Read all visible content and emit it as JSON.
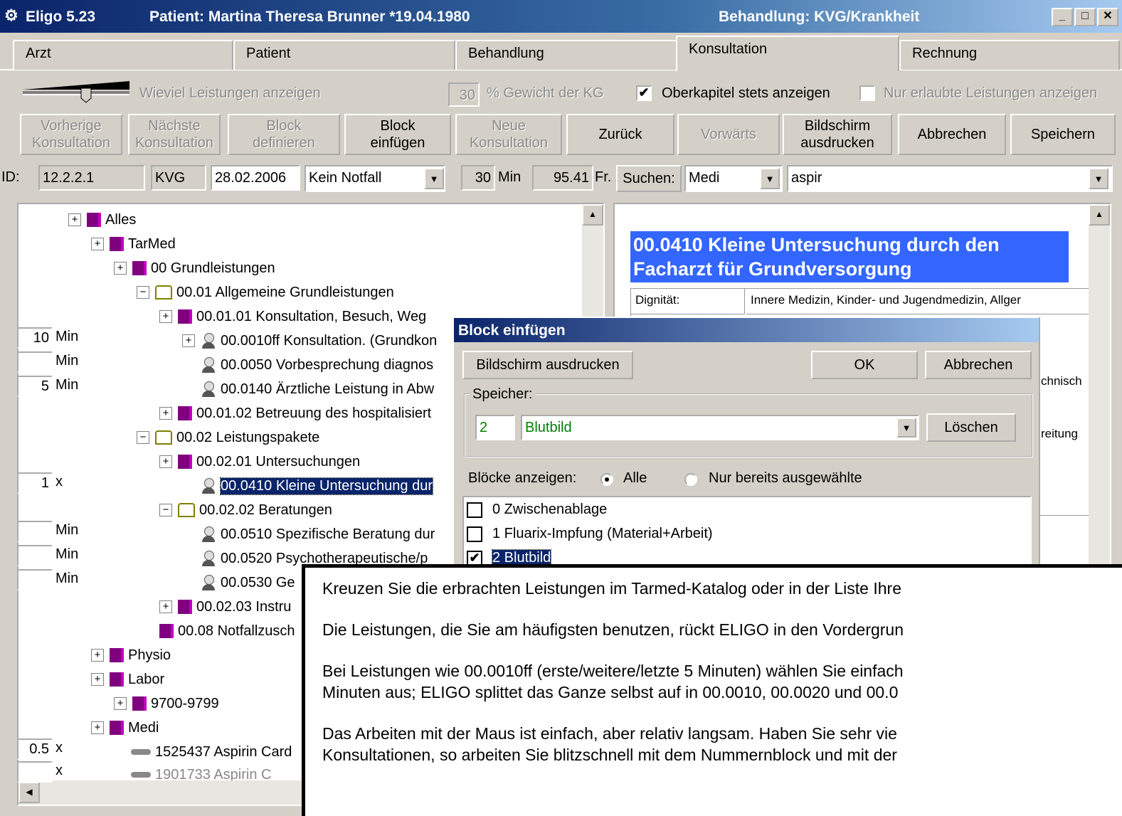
{
  "titlebar": {
    "app": "Eligo 5.23",
    "patient": "Patient: Martina Theresa Brunner *19.04.1980",
    "behandlung": "Behandlung: KVG/Krankheit"
  },
  "tabs": [
    "Arzt",
    "Patient",
    "Behandlung",
    "Konsultation",
    "Rechnung"
  ],
  "active_tab": "Konsultation",
  "options": {
    "slider_label": "Wieviel Leistungen anzeigen",
    "weight_value": "30",
    "weight_label": "% Gewicht der KG",
    "oberkapitel_label": "Oberkapitel stets anzeigen",
    "oberkapitel_checked": true,
    "nur_erlaubte_label": "Nur erlaubte Leistungen anzeigen",
    "nur_erlaubte_checked": false
  },
  "toolbar": {
    "vorherige": "Vorherige\nKonsultation",
    "naechste": "Nächste\nKonsultation",
    "block_def": "Block\ndefinieren",
    "block_einf": "Block\neinfügen",
    "neue": "Neue\nKonsultation",
    "zurueck": "Zurück",
    "vorwaerts": "Vorwärts",
    "drucken": "Bildschirm\nausdrucken",
    "abbrechen": "Abbrechen",
    "speichern": "Speichern"
  },
  "infobar": {
    "id_label": "ID:",
    "id_value": "12.2.2.1",
    "kvg": "KVG",
    "date": "28.02.2006",
    "notfall": "Kein Notfall",
    "min_value": "30",
    "min_label": "Min",
    "fr_value": "95.41",
    "fr_label": "Fr.",
    "suchen": "Suchen:",
    "search_cat": "Medi",
    "search_text": "aspir"
  },
  "tree": [
    {
      "text": "Alles",
      "icon": "book-icon",
      "pm": "+"
    },
    {
      "text": "TarMed",
      "icon": "book-icon",
      "pm": "+"
    },
    {
      "text": "00 Grundleistungen",
      "icon": "book-icon",
      "pm": "+"
    },
    {
      "text": "00.01 Allgemeine Grundleistungen",
      "icon": "open-book-icon",
      "pm": "−"
    },
    {
      "text": "00.01.01 Konsultation, Besuch, Weg",
      "icon": "book-icon",
      "pm": "+"
    },
    {
      "text": "00.0010ff Konsultation. (Grundkon",
      "icon": "person-icon",
      "pm": "+"
    },
    {
      "text": "00.0050 Vorbesprechung diagnos",
      "icon": "person-icon",
      "pm": ""
    },
    {
      "text": "00.0140 Ärztliche Leistung in Abw",
      "icon": "person-icon",
      "pm": ""
    },
    {
      "text": "00.01.02 Betreuung des hospitalisiert",
      "icon": "book-icon",
      "pm": "+"
    },
    {
      "text": "00.02 Leistungspakete",
      "icon": "open-book-icon",
      "pm": "−"
    },
    {
      "text": "00.02.01 Untersuchungen",
      "icon": "book-icon",
      "pm": "+"
    },
    {
      "text": "00.0410 Kleine Untersuchung dur",
      "icon": "person-icon",
      "pm": ""
    },
    {
      "text": "00.02.02 Beratungen",
      "icon": "open-book-icon",
      "pm": "−"
    },
    {
      "text": "00.0510 Spezifische Beratung dur",
      "icon": "person-icon",
      "pm": ""
    },
    {
      "text": "00.0520 Psychotherapeutische/p",
      "icon": "person-icon",
      "pm": ""
    },
    {
      "text": "00.0530 Ge",
      "icon": "person-icon",
      "pm": ""
    },
    {
      "text": "00.02.03 Instru",
      "icon": "book-icon",
      "pm": "+"
    },
    {
      "text": "00.08 Notfallzusch",
      "icon": "book-icon",
      "pm": ""
    },
    {
      "text": "Physio",
      "icon": "book-icon",
      "pm": "+"
    },
    {
      "text": "Labor",
      "icon": "book-icon",
      "pm": "+"
    },
    {
      "text": "9700-9799",
      "icon": "book-icon",
      "pm": "+"
    },
    {
      "text": "Medi",
      "icon": "book-icon",
      "pm": "+"
    },
    {
      "text": "1525437 Aspirin Card",
      "icon": "pill-icon",
      "pm": ""
    },
    {
      "text": "1901733 Aspirin C",
      "icon": "pill-icon",
      "pm": ""
    }
  ],
  "quantities": [
    {
      "value": "10",
      "unit": "Min"
    },
    {
      "value": "",
      "unit": "Min"
    },
    {
      "value": "5",
      "unit": "Min"
    },
    {
      "value": "1",
      "unit": "x"
    },
    {
      "value": "",
      "unit": "Min"
    },
    {
      "value": "",
      "unit": "Min"
    },
    {
      "value": "",
      "unit": "Min"
    },
    {
      "value": "0.5",
      "unit": "x"
    },
    {
      "value": "",
      "unit": "x"
    }
  ],
  "detail": {
    "heading": "00.0410 Kleine Untersuchung durch den Facharzt für Grundversorgung",
    "dignitaet_label": "Dignität:",
    "dignitaet_value": "Innere Medizin, Kinder- und Jugendmedizin, Allger",
    "frag1": "chnisch",
    "frag2": "reitung"
  },
  "dialog": {
    "title": "Block einfügen",
    "drucken": "Bildschirm ausdrucken",
    "ok": "OK",
    "abbrechen": "Abbrechen",
    "speicher_label": "Speicher:",
    "speicher_nr": "2",
    "speicher_name": "Blutbild",
    "loeschen": "Löschen",
    "bloecke_label": "Blöcke anzeigen:",
    "radio_alle": "Alle",
    "radio_nur": "Nur bereits ausgewählte",
    "items": [
      {
        "label": "0  Zwischenablage",
        "checked": false
      },
      {
        "label": "1  Fluarix-Impfung (Material+Arbeit)",
        "checked": false
      },
      {
        "label": "2  Blutbild",
        "checked": true
      }
    ]
  },
  "overlay": {
    "p1": "Kreuzen Sie die erbrachten Leistungen im Tarmed-Katalog oder in der Liste Ihre",
    "p2": "Die Leistungen, die Sie am häufigsten benutzen, rückt ELIGO in den Vordergrun",
    "p3a": "Bei Leistungen wie 00.0010ff (erste/weitere/letzte 5 Minuten) wählen Sie einfach",
    "p3b": "Minuten aus; ELIGO splittet das Ganze selbst auf in 00.0010, 00.0020 und 00.0",
    "p4a": "Das Arbeiten mit der Maus ist einfach, aber relativ langsam. Haben Sie sehr vie",
    "p4b": "Konsultationen, so arbeiten Sie blitzschnell mit dem Nummernblock und mit der"
  }
}
